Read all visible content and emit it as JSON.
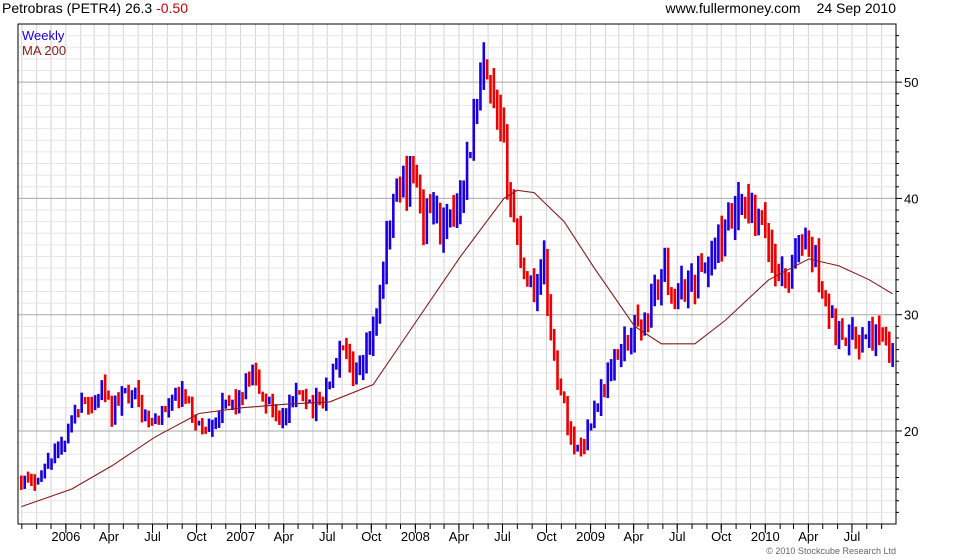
{
  "header": {
    "title": "Petrobras (PETR4)",
    "last": "26.3",
    "change": "-0.50",
    "site": "www.fullermoney.com",
    "date": "24 Sep 2010"
  },
  "footer": {
    "credit": "© 2010 Stockcube Research Ltd"
  },
  "colors": {
    "up": "#1a00e0",
    "down": "#ee0000",
    "ma": "#8b1a1a",
    "grid": "#d4d4d4"
  },
  "chart_data": {
    "type": "line",
    "legend": [
      {
        "name": "Weekly",
        "color": "#1a00e0"
      },
      {
        "name": "MA 200",
        "color": "#8b1a1a"
      }
    ],
    "x_tick_labels": [
      "2006",
      "Apr",
      "Jul",
      "Oct",
      "2007",
      "Apr",
      "Jul",
      "Oct",
      "2008",
      "Apr",
      "Jul",
      "Oct",
      "2009",
      "Apr",
      "Jul",
      "Oct",
      "2010",
      "Apr",
      "Jul"
    ],
    "y_ticks": [
      20,
      30,
      40,
      50
    ],
    "ylim": [
      12,
      55
    ],
    "xlim": [
      "2005-09-23",
      "2010-10-01"
    ],
    "series": [
      {
        "name": "Weekly",
        "type": "ohlc-bar",
        "points": [
          [
            "2005-09-30",
            16.0
          ],
          [
            "2005-10-21",
            15.5
          ],
          [
            "2005-11-11",
            16.5
          ],
          [
            "2005-12-02",
            18.0
          ],
          [
            "2005-12-23",
            18.5
          ],
          [
            "2006-01-13",
            21.0
          ],
          [
            "2006-02-03",
            23.0
          ],
          [
            "2006-02-24",
            22.0
          ],
          [
            "2006-03-17",
            23.5
          ],
          [
            "2006-04-07",
            21.5
          ],
          [
            "2006-04-28",
            23.0
          ],
          [
            "2006-05-19",
            24.0
          ],
          [
            "2006-06-09",
            21.5
          ],
          [
            "2006-06-30",
            20.5
          ],
          [
            "2006-07-21",
            21.5
          ],
          [
            "2006-08-11",
            22.5
          ],
          [
            "2006-09-01",
            23.0
          ],
          [
            "2006-09-22",
            21.5
          ],
          [
            "2006-10-13",
            20.0
          ],
          [
            "2006-11-03",
            21.0
          ],
          [
            "2006-11-24",
            22.0
          ],
          [
            "2006-12-15",
            22.5
          ],
          [
            "2007-01-05",
            23.0
          ],
          [
            "2007-01-26",
            24.5
          ],
          [
            "2007-02-16",
            23.0
          ],
          [
            "2007-03-09",
            22.0
          ],
          [
            "2007-03-30",
            21.0
          ],
          [
            "2007-04-20",
            22.5
          ],
          [
            "2007-05-11",
            23.5
          ],
          [
            "2007-06-01",
            22.0
          ],
          [
            "2007-06-22",
            23.0
          ],
          [
            "2007-07-13",
            25.0
          ],
          [
            "2007-08-03",
            27.5
          ],
          [
            "2007-08-24",
            24.0
          ],
          [
            "2007-09-14",
            25.5
          ],
          [
            "2007-10-05",
            28.5
          ],
          [
            "2007-10-26",
            33.5
          ],
          [
            "2007-11-16",
            40.0
          ],
          [
            "2007-12-07",
            41.5
          ],
          [
            "2007-12-28",
            42.5
          ],
          [
            "2008-01-18",
            38.0
          ],
          [
            "2008-02-08",
            39.5
          ],
          [
            "2008-02-29",
            37.0
          ],
          [
            "2008-03-21",
            38.5
          ],
          [
            "2008-04-11",
            42.0
          ],
          [
            "2008-05-02",
            46.0
          ],
          [
            "2008-05-23",
            50.5
          ],
          [
            "2008-06-13",
            48.0
          ],
          [
            "2008-07-04",
            44.0
          ],
          [
            "2008-07-25",
            38.0
          ],
          [
            "2008-08-15",
            34.0
          ],
          [
            "2008-09-05",
            32.0
          ],
          [
            "2008-09-26",
            34.5
          ],
          [
            "2008-10-17",
            26.0
          ],
          [
            "2008-11-07",
            22.0
          ],
          [
            "2008-11-28",
            18.5
          ],
          [
            "2008-12-19",
            19.0
          ],
          [
            "2009-01-09",
            22.0
          ],
          [
            "2009-01-30",
            24.0
          ],
          [
            "2009-02-20",
            26.0
          ],
          [
            "2009-03-13",
            27.5
          ],
          [
            "2009-04-03",
            29.0
          ],
          [
            "2009-04-24",
            29.5
          ],
          [
            "2009-05-15",
            32.0
          ],
          [
            "2009-06-05",
            34.0
          ],
          [
            "2009-06-26",
            31.0
          ],
          [
            "2009-07-17",
            32.5
          ],
          [
            "2009-08-07",
            33.0
          ],
          [
            "2009-08-28",
            34.0
          ],
          [
            "2009-09-18",
            35.5
          ],
          [
            "2009-10-09",
            37.0
          ],
          [
            "2009-10-30",
            38.5
          ],
          [
            "2009-11-20",
            39.5
          ],
          [
            "2009-12-11",
            38.0
          ],
          [
            "2010-01-01",
            37.0
          ],
          [
            "2010-01-22",
            34.0
          ],
          [
            "2010-02-12",
            33.0
          ],
          [
            "2010-03-05",
            35.0
          ],
          [
            "2010-03-26",
            36.5
          ],
          [
            "2010-04-16",
            34.5
          ],
          [
            "2010-05-07",
            31.0
          ],
          [
            "2010-05-28",
            29.0
          ],
          [
            "2010-06-18",
            28.5
          ],
          [
            "2010-07-09",
            27.5
          ],
          [
            "2010-07-30",
            28.0
          ],
          [
            "2010-08-20",
            28.5
          ],
          [
            "2010-09-10",
            27.5
          ],
          [
            "2010-09-24",
            26.3
          ]
        ]
      },
      {
        "name": "MA 200",
        "points": [
          [
            "2005-09-30",
            13.5
          ],
          [
            "2006-01-13",
            15.0
          ],
          [
            "2006-04-07",
            17.0
          ],
          [
            "2006-07-07",
            19.5
          ],
          [
            "2006-10-06",
            21.5
          ],
          [
            "2007-01-05",
            22.0
          ],
          [
            "2007-04-06",
            22.3
          ],
          [
            "2007-07-06",
            22.5
          ],
          [
            "2007-10-05",
            24.0
          ],
          [
            "2008-01-04",
            29.5
          ],
          [
            "2008-04-04",
            35.0
          ],
          [
            "2008-07-04",
            40.0
          ],
          [
            "2008-08-01",
            40.7
          ],
          [
            "2008-09-05",
            40.5
          ],
          [
            "2008-11-07",
            38.0
          ],
          [
            "2009-01-09",
            34.0
          ],
          [
            "2009-04-03",
            29.0
          ],
          [
            "2009-05-29",
            27.5
          ],
          [
            "2009-08-07",
            27.5
          ],
          [
            "2009-10-09",
            29.5
          ],
          [
            "2010-01-08",
            33.0
          ],
          [
            "2010-04-02",
            34.8
          ],
          [
            "2010-06-04",
            34.2
          ],
          [
            "2010-08-06",
            33.0
          ],
          [
            "2010-09-24",
            31.8
          ]
        ]
      }
    ]
  }
}
